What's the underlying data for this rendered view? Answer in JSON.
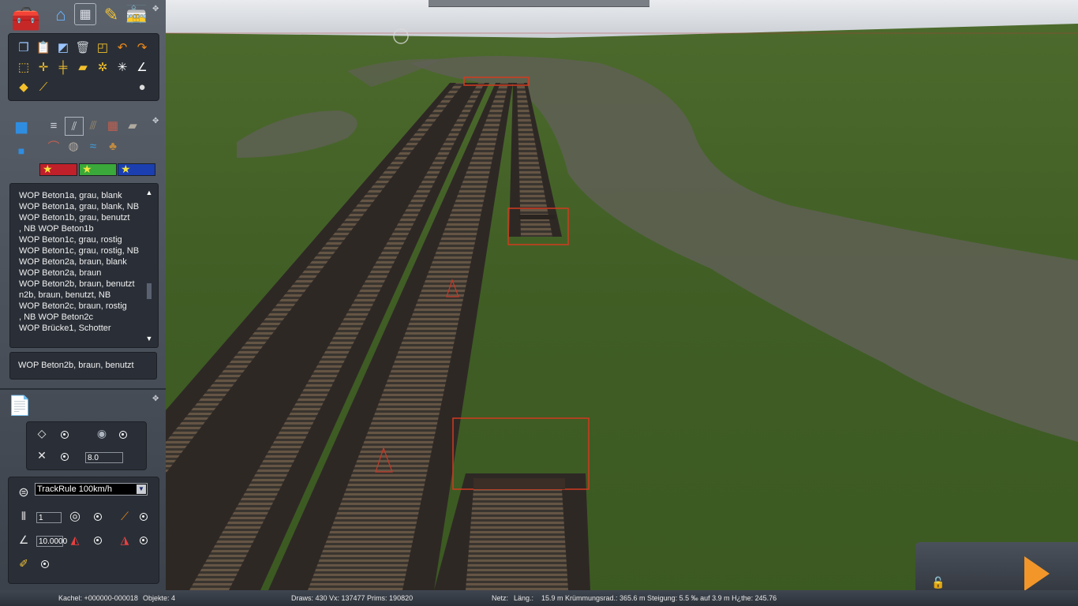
{
  "toolbar_top": {
    "icons": [
      "toolbox-icon",
      "home-icon",
      "track-icon",
      "paint-icon",
      "train-icon"
    ]
  },
  "edit_tools": {
    "row1": [
      "copy-icon",
      "paste-icon",
      "eraser-icon",
      "trash-icon",
      "paint-bucket-icon",
      "undo-icon",
      "redo-icon"
    ],
    "row2": [
      "select-rect-icon",
      "move-icon",
      "split-icon",
      "lay-track-icon",
      "junction-icon",
      "pivot-icon",
      "angle-icon"
    ],
    "row3": [
      "marker-icon",
      "ruler-icon",
      "bomb-icon"
    ]
  },
  "asset_panel": {
    "categories": [
      "track-list-icon",
      "track-straight-icon",
      "track-rail-icon",
      "brick-icon",
      "block-icon"
    ],
    "row2": [
      "bridge-icon",
      "tunnel-icon",
      "water-icon",
      "bag-icon"
    ],
    "rating_colors": [
      "#c0202a",
      "#3aa83a",
      "#1b3fb0"
    ]
  },
  "asset_list": {
    "items": [
      "WOP Beton1a, grau, blank",
      "WOP Beton1a, grau, blank, NB",
      "WOP Beton1b, grau, benutzt",
      ", NB                    WOP Beton1b",
      "WOP Beton1c, grau, rostig",
      "WOP Beton1c, grau, rostig, NB",
      "WOP Beton2a, braun, blank",
      "                  WOP Beton2a, braun",
      "WOP Beton2b, braun, benutzt",
      "n2b, braun, benutzt, NB",
      "WOP Beton2c, braun, rostig",
      ", NB                    WOP Beton2c",
      "WOP Brücke1, Schotter"
    ],
    "selected": "WOP Beton2b, braun, benutzt"
  },
  "properties_panel": {
    "height_value": "8.0"
  },
  "track_panel": {
    "rule": "TrackRule 100km/h",
    "count_value": "1",
    "angle_value": "10.0000"
  },
  "status": {
    "kachel": "Kachel: +000000-000018",
    "objekte": "Objekte: 4",
    "draws": "Draws: 430 Vx: 137477 Prims: 190820",
    "netz": "Netz:",
    "laenge": "Läng.:",
    "details": "15.9 m Krümmungsrad.: 365.6 m Steigung:  5.5 ‰ auf  3.9 m H¿the: 245.76"
  }
}
